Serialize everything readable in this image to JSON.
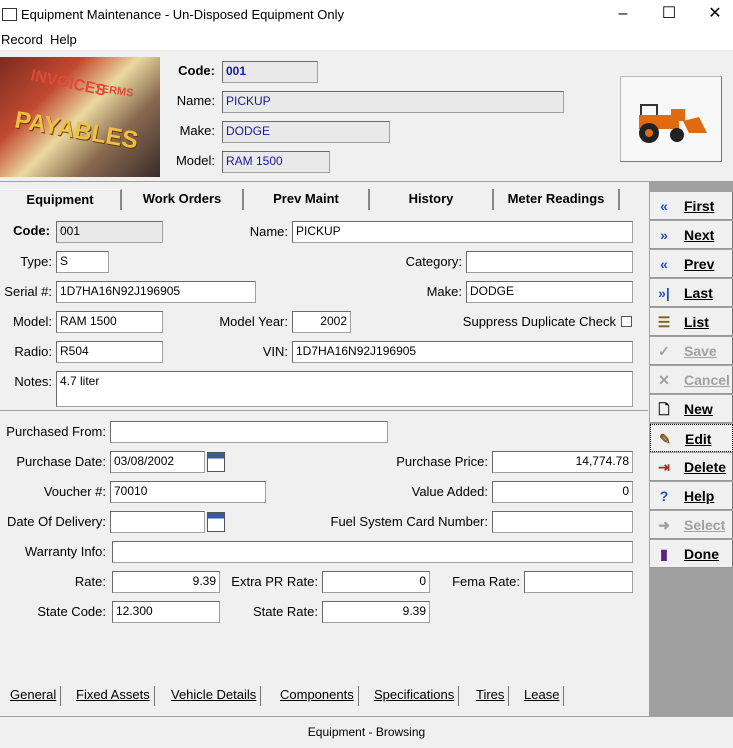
{
  "window": {
    "title": "Equipment Maintenance - Un-Disposed Equipment Only"
  },
  "menu": {
    "record": "Record",
    "help": "Help"
  },
  "header": {
    "banner": {
      "w1": "INVOICES",
      "w2": "TERMS",
      "w3": "PAYABLES"
    },
    "code_label": "Code:",
    "code": "001",
    "name_label": "Name:",
    "name": "PICKUP",
    "make_label": "Make:",
    "make": "DODGE",
    "model_label": "Model:",
    "model": "RAM 1500"
  },
  "tabs_top": [
    "Equipment",
    "Work Orders",
    "Prev Maint",
    "History",
    "Meter Readings"
  ],
  "equipment": {
    "code_label": "Code:",
    "code": "001",
    "name_label": "Name:",
    "name": "PICKUP",
    "type_label": "Type:",
    "type": "S",
    "category_label": "Category:",
    "category": "",
    "serial_label": "Serial #:",
    "serial": "1D7HA16N92J196905",
    "make_label": "Make:",
    "make": "DODGE",
    "model_label": "Model:",
    "model": "RAM 1500",
    "model_year_label": "Model Year:",
    "model_year": "2002",
    "suppress_label": "Suppress Duplicate Check",
    "radio_label": "Radio:",
    "radio": "R504",
    "vin_label": "VIN:",
    "vin": "1D7HA16N92J196905",
    "notes_label": "Notes:",
    "notes": "4.7 liter"
  },
  "general": {
    "purchased_from_label": "Purchased From:",
    "purchased_from": "",
    "purchase_date_label": "Purchase Date:",
    "purchase_date": "03/08/2002",
    "purchase_price_label": "Purchase Price:",
    "purchase_price": "14,774.78",
    "voucher_label": "Voucher #:",
    "voucher": "70010",
    "value_added_label": "Value Added:",
    "value_added": "0",
    "delivery_label": "Date Of Delivery:",
    "delivery": "",
    "fuel_card_label": "Fuel System Card Number:",
    "fuel_card": "",
    "warranty_label": "Warranty Info:",
    "warranty": "",
    "rate_label": "Rate:",
    "rate": "9.39",
    "extra_pr_label": "Extra PR Rate:",
    "extra_pr": "0",
    "fema_label": "Fema Rate:",
    "fema": "",
    "state_code_label": "State Code:",
    "state_code": "12.300",
    "state_rate_label": "State Rate:",
    "state_rate": "9.39"
  },
  "sidebar": [
    {
      "label": "First",
      "icon": "«"
    },
    {
      "label": "Next",
      "icon": "»"
    },
    {
      "label": "Prev",
      "icon": "«"
    },
    {
      "label": "Last",
      "icon": "»|"
    },
    {
      "label": "List",
      "icon": "☰"
    },
    {
      "label": "Save",
      "icon": "✓"
    },
    {
      "label": "Cancel",
      "icon": "✕"
    },
    {
      "label": "New",
      "icon": "🗋"
    },
    {
      "label": "Edit",
      "icon": "✎"
    },
    {
      "label": "Delete",
      "icon": "⇥"
    },
    {
      "label": "Help",
      "icon": "?"
    },
    {
      "label": "Select",
      "icon": "➜"
    },
    {
      "label": "Done",
      "icon": "▮"
    }
  ],
  "tabs_bottom": [
    "General",
    "Fixed Assets",
    "Vehicle Details",
    "Components",
    "Specifications",
    "Tires",
    "Lease"
  ],
  "status": "Equipment - Browsing",
  "colors": {
    "field_blue": "#1a1a9a",
    "sidebar_bg": "#a0a0a0"
  }
}
